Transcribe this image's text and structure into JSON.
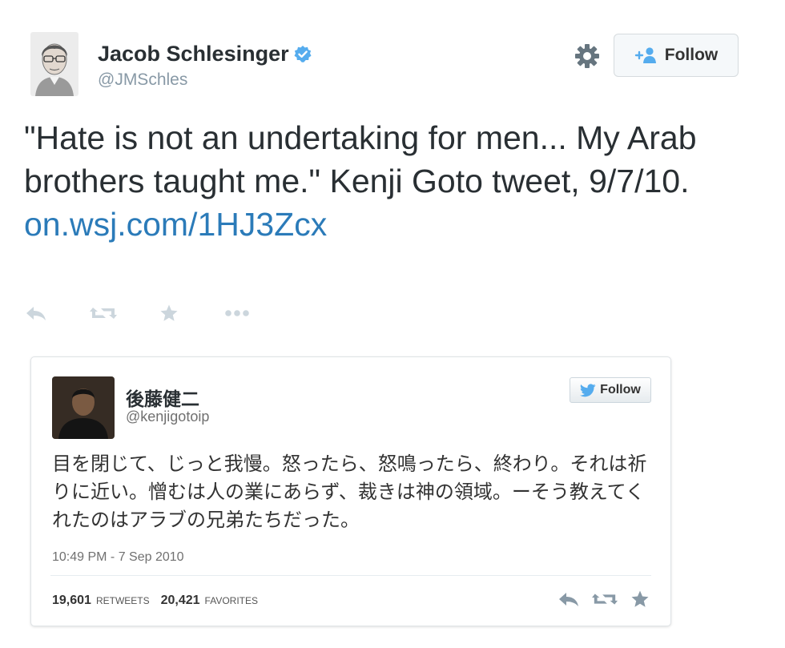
{
  "tweet": {
    "author_name": "Jacob Schlesinger",
    "author_handle": "@JMSchles",
    "follow_label": "Follow",
    "text": "\"Hate is not an undertaking for men... My Arab brothers taught me.\" Kenji Goto tweet, 9/7/10.",
    "link": "on.wsj.com/1HJ3Zcx",
    "icons": [
      "reply-icon",
      "retweet-icon",
      "favorite-icon",
      "more-icon",
      "gear-icon",
      "verified-badge-icon",
      "add-user-icon"
    ]
  },
  "embed": {
    "author_name": "後藤健二",
    "author_handle": "@kenjigotoip",
    "follow_label": "Follow",
    "text": "目を閉じて、じっと我慢。怒ったら、怒鳴ったら、終わり。それは祈りに近い。憎むは人の業にあらず、裁きは神の領域。ーそう教えてくれたのはアラブの兄弟たちだった。",
    "timestamp": "10:49 PM - 7 Sep 2010",
    "retweets_count": "19,601",
    "retweets_label": "RETWEETS",
    "favorites_count": "20,421",
    "favorites_label": "FAVORITES",
    "icons": [
      "twitter-bird-icon",
      "reply-icon",
      "retweet-icon",
      "favorite-icon"
    ]
  },
  "colors": {
    "link": "#2b7bb9",
    "verified": "#55acee",
    "action_icon": "#ccd6dd",
    "embed_icon": "#8899a6"
  }
}
